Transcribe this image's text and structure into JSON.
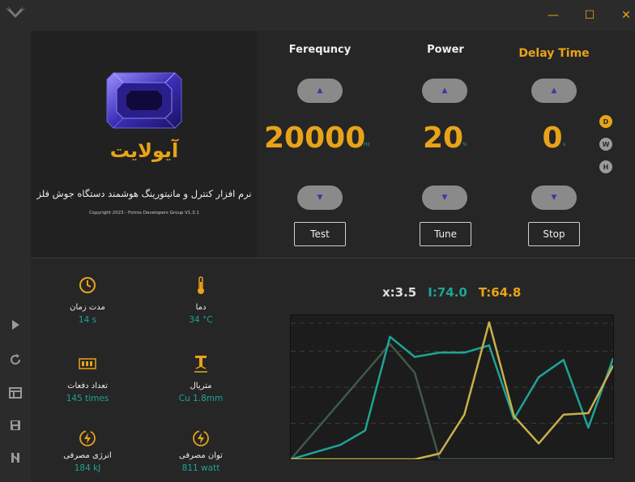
{
  "window": {
    "minimize": "—",
    "maximize": "☐",
    "close": "✕"
  },
  "app": {
    "name": "آیولایت",
    "description": "نرم افزار کنترل و مانیتورینگ هوشمند دستگاه جوش فلز",
    "copyright": "Copyright 2023 - Fotros Developers Group   V1.3.1"
  },
  "controls": [
    {
      "title": "Ferequncy",
      "value": "20000",
      "unit": "Hz",
      "button": "Test"
    },
    {
      "title": "Power",
      "value": "20",
      "unit": "%",
      "button": "Tune"
    },
    {
      "title": "Delay Time",
      "value": "0",
      "unit": "s",
      "button": "Stop"
    }
  ],
  "modes": [
    {
      "label": "D",
      "color": "#e8a317"
    },
    {
      "label": "W",
      "color": "#9a9a9a"
    },
    {
      "label": "H",
      "color": "#9a9a9a"
    }
  ],
  "stats": [
    {
      "label": "مدت زمان",
      "value": "14 s",
      "icon": "clock-icon"
    },
    {
      "label": "دما",
      "value": "34 °C",
      "icon": "thermometer-icon"
    },
    {
      "label": "تعداد دفعات",
      "value": "145 times",
      "icon": "counter-icon"
    },
    {
      "label": "متریال",
      "value": "Cu 1.8mm",
      "icon": "welding-tip-icon"
    },
    {
      "label": "انرژی مصرفی",
      "value": "184 kJ",
      "icon": "energy-icon"
    },
    {
      "label": "توان مصرفی",
      "value": "811 watt",
      "icon": "power-icon"
    }
  ],
  "readouts": {
    "x": "x:3.5",
    "i": "I:74.0",
    "t": "T:64.8"
  },
  "chart_data": {
    "type": "line",
    "x": [
      0,
      1,
      2,
      3,
      4,
      5,
      6,
      7,
      8,
      9,
      10,
      11,
      12,
      13
    ],
    "series": [
      {
        "color": "#3f5a48",
        "values": [
          0,
          20,
          40,
          60,
          80,
          60,
          0,
          0,
          0,
          0,
          0,
          0,
          0,
          0
        ]
      },
      {
        "color": "#1fa396",
        "values": [
          0,
          5,
          10,
          20,
          85,
          71,
          74,
          74,
          79,
          28,
          57,
          69,
          22,
          70
        ]
      },
      {
        "color": "#c8b04a",
        "values": [
          0,
          0,
          0,
          0,
          0,
          0,
          4,
          31,
          95,
          30,
          11,
          31,
          32,
          65
        ]
      }
    ],
    "ylim": [
      0,
      100
    ],
    "grid": true
  }
}
